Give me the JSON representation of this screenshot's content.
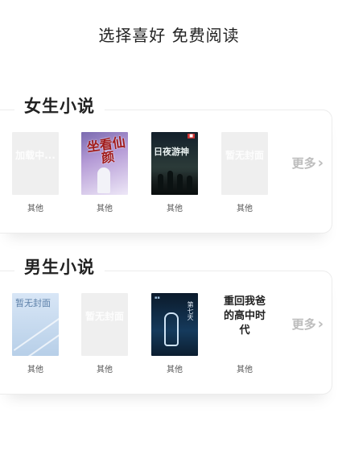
{
  "page": {
    "title": "选择喜好 免费阅读"
  },
  "sections": [
    {
      "title": "女生小说",
      "more": "更多",
      "books": [
        {
          "kind": "placeholder",
          "placeholder_text": "加载中...",
          "category": "其他"
        },
        {
          "kind": "cover",
          "cover_text": "坐看仙颜",
          "category": "其他"
        },
        {
          "kind": "cover",
          "cover_text": "日夜游神",
          "category": "其他"
        },
        {
          "kind": "placeholder",
          "placeholder_text": "暂无封面",
          "category": "其他"
        }
      ]
    },
    {
      "title": "男生小说",
      "more": "更多",
      "books": [
        {
          "kind": "cover",
          "cover_text": "暂无封面",
          "category": "其他"
        },
        {
          "kind": "placeholder",
          "placeholder_text": "暂无封面",
          "category": "其他"
        },
        {
          "kind": "cover",
          "cover_text": "第七天",
          "category": "其他"
        },
        {
          "kind": "cover",
          "cover_text": "重回我爸的高中时代",
          "category": "其他"
        }
      ]
    }
  ]
}
